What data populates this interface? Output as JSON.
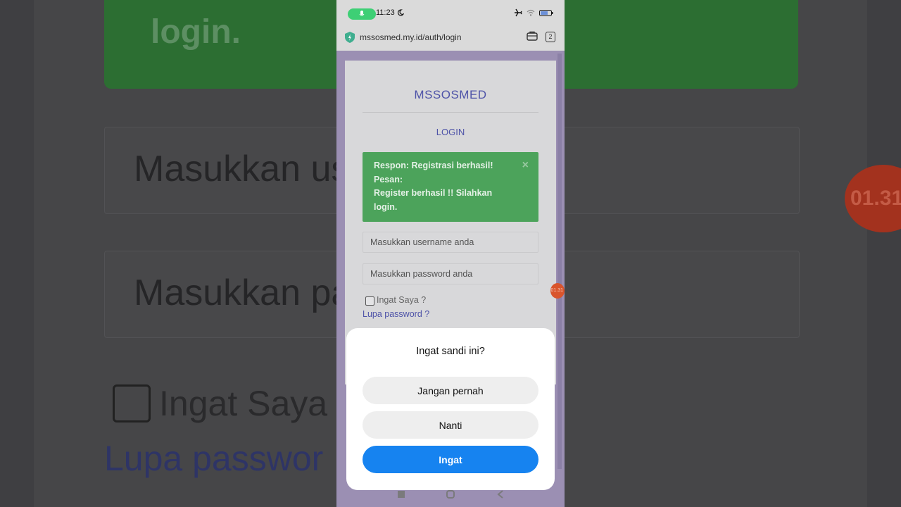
{
  "background": {
    "header_text": "login.",
    "username_placeholder": "Masukkan us",
    "password_placeholder": "Masukkan pa",
    "remember_label": "Ingat Saya",
    "forgot_link": "Lupa passwor",
    "badge_text": "01.31"
  },
  "status_bar": {
    "time": "11:23",
    "battery": "63"
  },
  "browser": {
    "url": "mssosmed.my.id/auth/login",
    "tab_count": "2"
  },
  "page": {
    "brand": "MSSOSMED",
    "heading": "LOGIN",
    "alert": {
      "line1": "Respon: Registrasi berhasil!",
      "line2": "Pesan:",
      "line3": "Register berhasil !! Silahkan",
      "line4": "login.",
      "close": "×"
    },
    "username_placeholder": "Masukkan username anda",
    "password_placeholder": "Masukkan password anda",
    "remember_label": "Ingat Saya ?",
    "forgot_link": "Lupa password ?",
    "badge_text": "01.31"
  },
  "dialog": {
    "title": "Ingat sandi ini?",
    "never_label": "Jangan pernah",
    "later_label": "Nanti",
    "remember_label": "Ingat"
  },
  "colors": {
    "brand": "#4e53a8",
    "alert_green": "#4ca35b",
    "primary_button": "#1683f0"
  }
}
